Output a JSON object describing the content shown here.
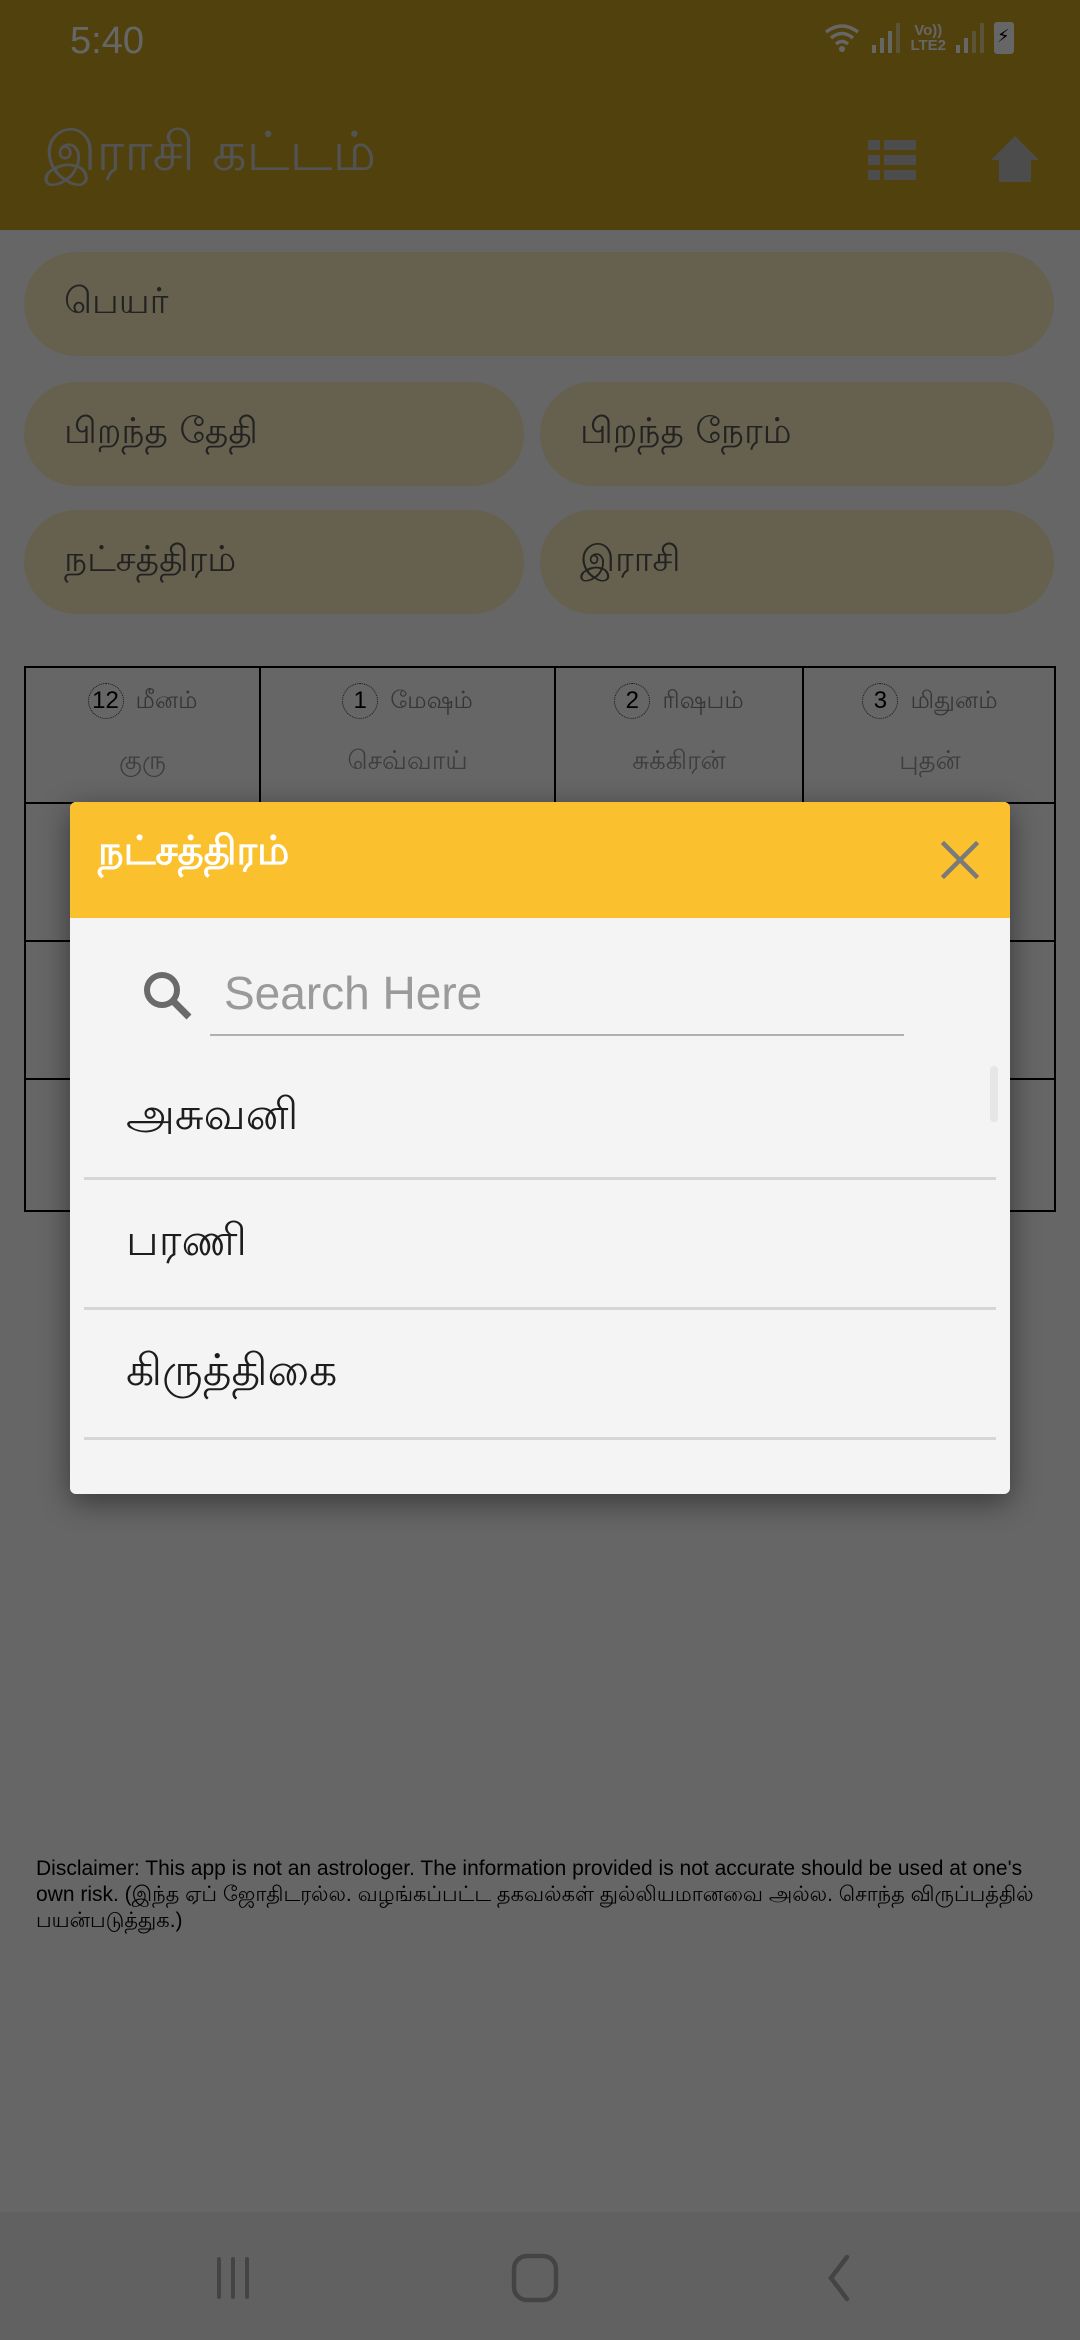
{
  "status_bar": {
    "time": "5:40",
    "network_label_top": "Vo))",
    "network_label_bottom": "LTE2",
    "battery_level": "charging"
  },
  "app_bar": {
    "title": "இராசி கட்டம்",
    "list_icon": "list-icon",
    "home_icon": "home-icon"
  },
  "form": {
    "name_placeholder": "பெயர்",
    "birth_date_placeholder": "பிறந்த தேதி",
    "birth_time_placeholder": "பிறந்த நேரம்",
    "star_placeholder": "நட்சத்திரம்",
    "rasi_placeholder": "இராசி"
  },
  "chart": {
    "top_row": [
      {
        "number": "12",
        "sign": "மீனம்",
        "planet": "குரு"
      },
      {
        "number": "1",
        "sign": "மேஷம்",
        "planet": "செவ்வாய்"
      },
      {
        "number": "2",
        "sign": "ரிஷபம்",
        "planet": "சுக்கிரன்"
      },
      {
        "number": "3",
        "sign": "மிதுனம்",
        "planet": "புதன்"
      }
    ]
  },
  "disclaimer": "Disclaimer: This app is not an astrologer. The information provided is not accurate should be used at one's own risk. (இந்த ஏப் ஜோதிடரல்ல. வழங்கப்பட்ட தகவல்கள் துல்லியமானவை அல்ல. சொந்த விருப்பத்தில் பயன்படுத்துக.)",
  "dialog": {
    "title": "நட்சத்திரம்",
    "close_icon": "close-icon",
    "search": {
      "placeholder": "Search Here",
      "value": ""
    },
    "items": [
      {
        "label": "அசுவனி"
      },
      {
        "label": "பரணி"
      },
      {
        "label": "கிருத்திகை"
      }
    ]
  },
  "nav_bar": {
    "recents_icon": "recents-icon",
    "home_icon": "home-circle-icon",
    "back_icon": "back-icon"
  },
  "colors": {
    "primary": "#c9a221",
    "dialog_header": "#fbc02d",
    "pill_bg": "#fdf2c3"
  }
}
